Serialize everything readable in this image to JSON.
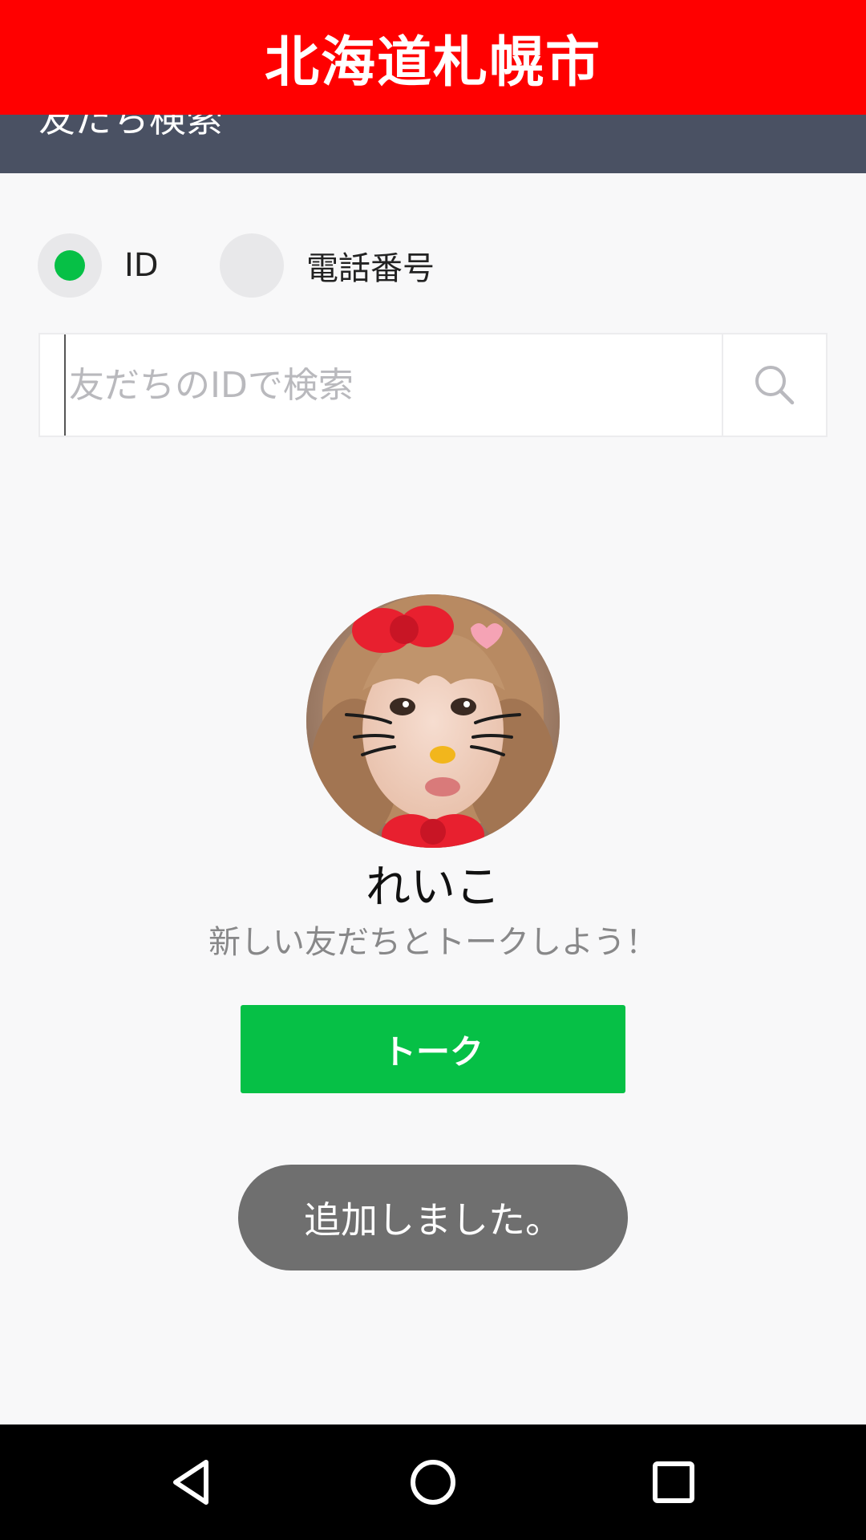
{
  "banner": {
    "location": "北海道札幌市",
    "color": "#ff0000"
  },
  "header": {
    "title": "友だち検索",
    "color": "#4a5163"
  },
  "search_type": {
    "options": [
      {
        "label": "ID",
        "selected": true
      },
      {
        "label": "電話番号",
        "selected": false
      }
    ],
    "selected_color": "#06c046"
  },
  "search": {
    "placeholder": "友だちのIDで検索",
    "value": "",
    "icon": "search-icon"
  },
  "profile": {
    "name": "れいこ",
    "subtitle": "新しい友だちとトークしよう！"
  },
  "talk_button": {
    "label": "トーク",
    "color": "#06c046"
  },
  "toast": {
    "message": "追加しました。"
  },
  "nav_bar": {
    "icons": [
      "back-icon",
      "home-icon",
      "recents-icon"
    ]
  }
}
